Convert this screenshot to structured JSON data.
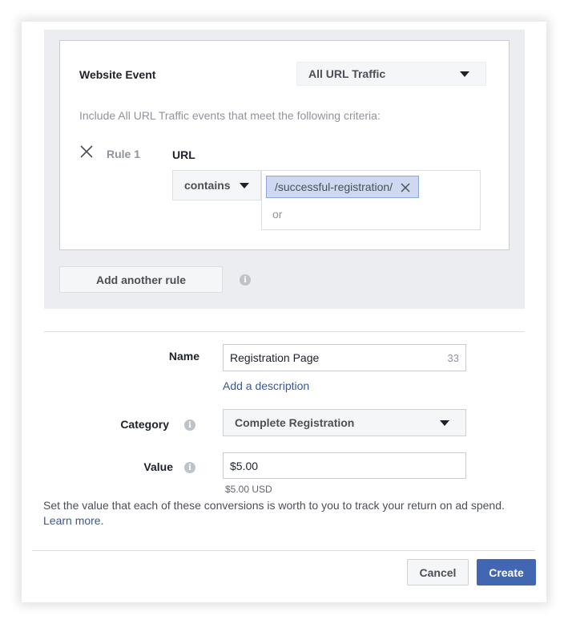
{
  "rules_section": {
    "website_event_label": "Website Event",
    "website_event_value": "All URL Traffic",
    "criteria_text": "Include All URL Traffic events that meet the following criteria:",
    "rule": {
      "name": "Rule 1",
      "field_label": "URL",
      "operator": "contains",
      "tokens": [
        "/successful-registration/"
      ],
      "or_text": "or"
    },
    "add_rule_label": "Add another rule"
  },
  "form": {
    "name_label": "Name",
    "name_value": "Registration Page",
    "name_char_count": "33",
    "add_description_link": "Add a description",
    "category_label": "Category",
    "category_value": "Complete Registration",
    "value_label": "Value",
    "value_value": "$5.00",
    "value_hint": "$5.00 USD",
    "value_description": "Set the value that each of these conversions is worth to you to track your return on ad spend.",
    "learn_more_link": "Learn more."
  },
  "footer": {
    "cancel_label": "Cancel",
    "create_label": "Create"
  },
  "icons": {
    "info": "info-icon",
    "close": "close-icon",
    "caret": "caret-down-icon"
  },
  "colors": {
    "primary": "#4267b2",
    "link": "#365899",
    "token_bg": "#ced9f1",
    "panel_bg": "#ebedf0"
  }
}
